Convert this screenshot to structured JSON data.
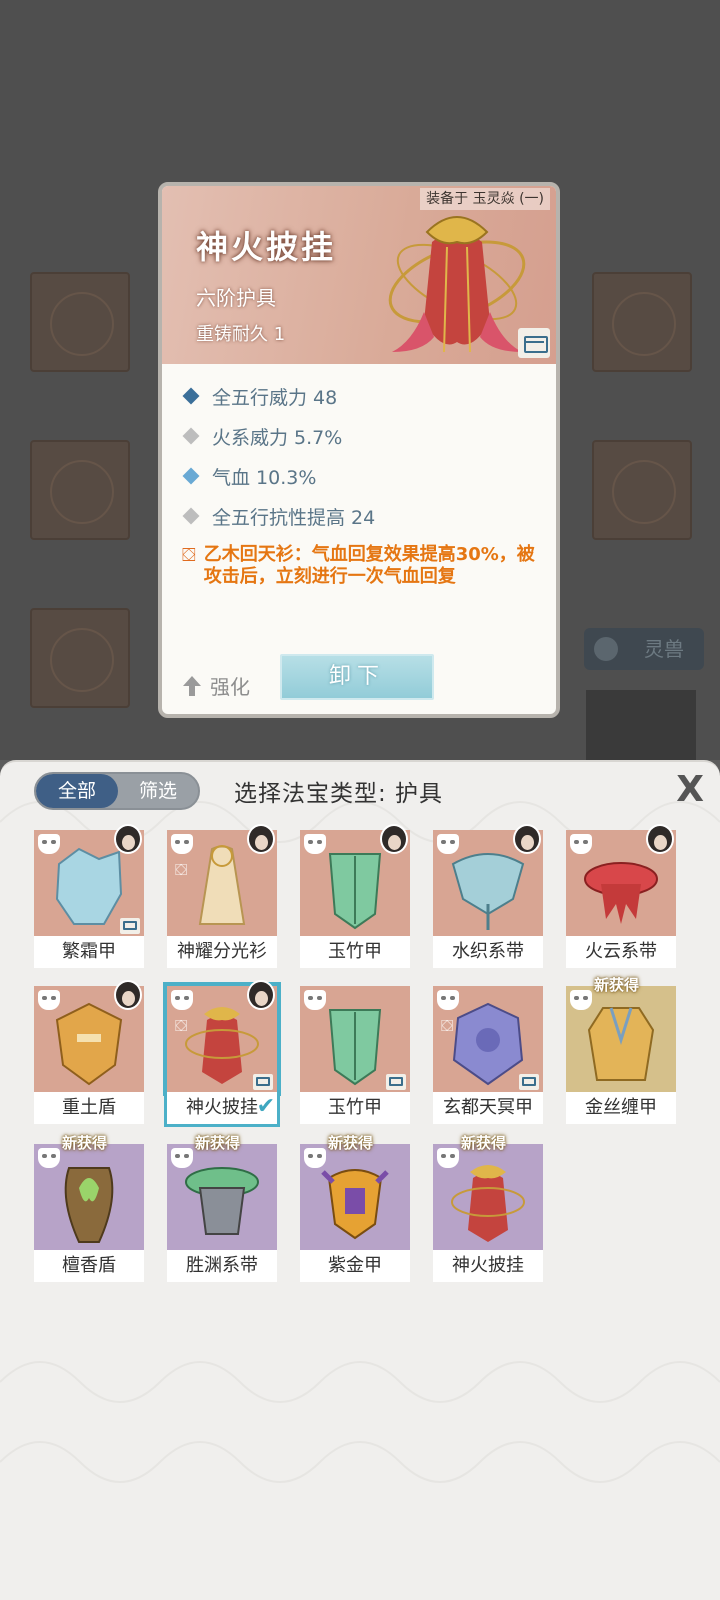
{
  "background": {
    "spirit_beast_label": "灵兽"
  },
  "detail": {
    "equipped_on": "装备于 玉灵焱 (一)",
    "name": "神火披挂",
    "tier": "六阶护具",
    "durability": "重铸耐久 1",
    "stats": [
      {
        "text": "全五行威力 48",
        "color": "blue"
      },
      {
        "text": "火系威力 5.7%",
        "color": "grey"
      },
      {
        "text": "气血 10.3%",
        "color": "cyan"
      },
      {
        "text": "全五行抗性提高 24",
        "color": "grey"
      }
    ],
    "special": "乙木回天衫：气血回复效果提高30%，被攻击后，立刻进行一次气血回复",
    "enhance_label": "强化",
    "unequip_label": "卸下"
  },
  "panel": {
    "tab_all": "全部",
    "tab_filter": "筛选",
    "title": "选择法宝类型: 护具",
    "close": "X",
    "new_tag": "新获得",
    "items": [
      {
        "name": "繁霜甲",
        "color": "red"
      },
      {
        "name": "神耀分光衫",
        "color": "red"
      },
      {
        "name": "玉竹甲",
        "color": "red"
      },
      {
        "name": "水织系带",
        "color": "red"
      },
      {
        "name": "火云系带",
        "color": "red"
      },
      {
        "name": "重土盾",
        "color": "red"
      },
      {
        "name": "神火披挂",
        "color": "red",
        "selected": true
      },
      {
        "name": "玉竹甲",
        "color": "red"
      },
      {
        "name": "玄都天冥甲",
        "color": "red"
      },
      {
        "name": "金丝缠甲",
        "color": "gold",
        "new": true
      },
      {
        "name": "檀香盾",
        "color": "purple",
        "new": true
      },
      {
        "name": "胜渊系带",
        "color": "purple",
        "new": true
      },
      {
        "name": "紫金甲",
        "color": "purple",
        "new": true
      },
      {
        "name": "神火披挂",
        "color": "purple",
        "new": true
      }
    ]
  },
  "colors": {
    "accent_blue": "#3f5f86",
    "special_orange": "#e57612",
    "selected_outline": "#4cb0c8"
  }
}
